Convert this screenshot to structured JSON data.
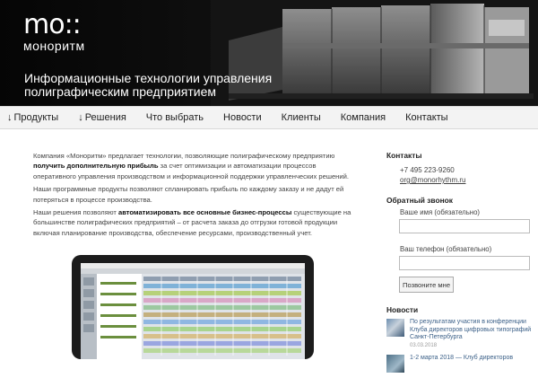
{
  "hero": {
    "logo_mark": "mo::",
    "logo_name": "моноритм",
    "tagline": "Информационные технологии управления полиграфическим предприятием"
  },
  "nav": [
    {
      "label": "Продукты",
      "arrow": "↓"
    },
    {
      "label": "Решения",
      "arrow": "↓"
    },
    {
      "label": "Что выбрать"
    },
    {
      "label": "Новости"
    },
    {
      "label": "Клиенты"
    },
    {
      "label": "Компания"
    },
    {
      "label": "Контакты"
    }
  ],
  "main": {
    "p1_a": "Компания «Моноритм» предлагает технологии, позволяющие полиграфическому предприятию",
    "p1_b": "получить дополнительную прибыль",
    "p1_c": "за счет оптимизации и автоматизации процессов оперативного управления производством и информационной поддержки управленческих решений.",
    "p2": "Наши программные продукты позволяют спланировать прибыль по каждому заказу и не дадут ей потеряться в процессе производства.",
    "p3_a": "Наши решения позволяют",
    "p3_b": "автоматизировать все основные бизнес-процессы",
    "p3_c": "существующие на большинстве полиграфических предприятий – от расчета заказа до отгрузки готовой продукции включая планирование производства, обеспечение ресурсами, производственный учет."
  },
  "sidebar": {
    "contacts_title": "Контакты",
    "phone": "+7 495 223-9260",
    "email": "org@monorhythm.ru",
    "callback_title": "Обратный звонок",
    "name_label": "Ваше имя (обязательно)",
    "phone_label": "Ваш телефон (обязательно)",
    "submit_label": "Позвоните мне",
    "news_title": "Новости",
    "news": [
      {
        "text": "По результатам участия в конференции Клуба директоров цифровых типографий Санкт-Петербурга",
        "date": "03.03.2018"
      },
      {
        "text": "1-2 марта 2018 — Клуб директоров",
        "date": ""
      }
    ]
  }
}
